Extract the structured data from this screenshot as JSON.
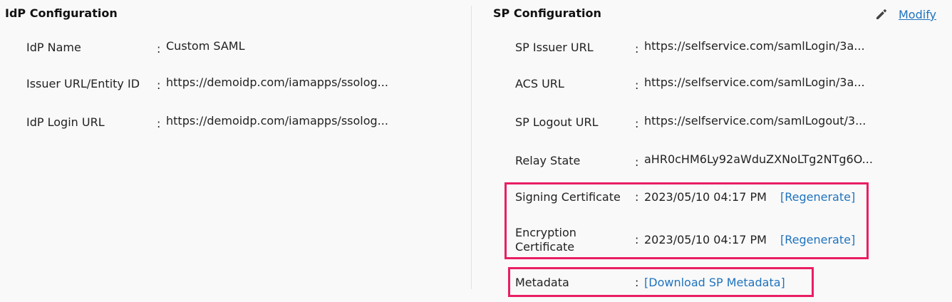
{
  "idp": {
    "title": "IdP Configuration",
    "fields": [
      {
        "label": "IdP Name",
        "value": "Custom SAML"
      },
      {
        "label": "Issuer URL/Entity ID",
        "value": "https://demoidp.com/iamapps/ssolog..."
      },
      {
        "label": "IdP Login URL",
        "value": "https://demoidp.com/iamapps/ssolog..."
      }
    ]
  },
  "sp": {
    "title": "SP Configuration",
    "modify_label": "Modify",
    "fields": [
      {
        "label": "SP Issuer URL",
        "value": "https://selfservice.com/samlLogin/3a..."
      },
      {
        "label": "ACS URL",
        "value": "https://selfservice.com/samlLogin/3a..."
      },
      {
        "label": "SP Logout URL",
        "value": "https://selfservice.com/samlLogout/3..."
      },
      {
        "label": "Relay State",
        "value": "aHR0cHM6Ly92aWduZXNoLTg2NTg6O..."
      }
    ],
    "signing": {
      "label": "Signing Certificate",
      "value": "2023/05/10 04:17 PM",
      "action": "[Regenerate]"
    },
    "encryption": {
      "label_line1": "Encryption",
      "label_line2": "Certificate",
      "value": "2023/05/10 04:17 PM",
      "action": "[Regenerate]"
    },
    "metadata": {
      "label": "Metadata",
      "action": "[Download SP Metadata]"
    }
  },
  "separator": ":",
  "colors": {
    "link": "#1e73be",
    "highlight": "#e91e63"
  },
  "icons": {
    "modify": "pencil-icon"
  }
}
